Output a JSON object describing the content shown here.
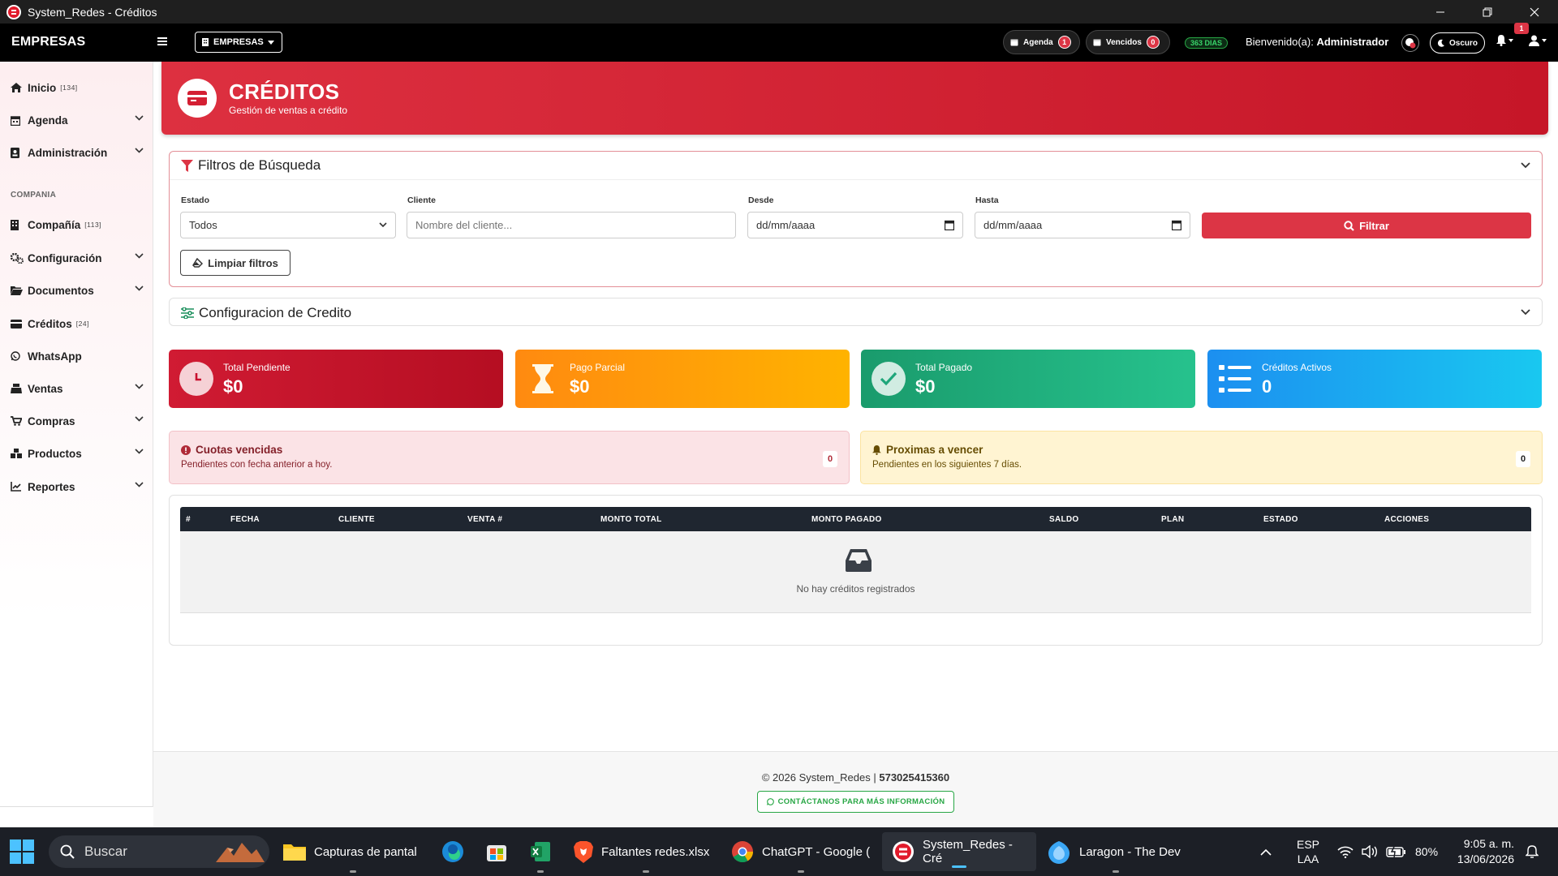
{
  "window": {
    "title": "System_Redes - Créditos"
  },
  "navbar": {
    "brand": "EMPRESAS",
    "empresas_button": "EMPRESAS",
    "agenda_label": "Agenda",
    "agenda_count": "1",
    "vencidos_label": "Vencidos",
    "vencidos_count": "0",
    "days_badge": "363 DIAS",
    "welcome_prefix": "Bienvenido(a):",
    "welcome_user": "Administrador",
    "dark_mode_label": "Oscuro",
    "notifications_count": "1"
  },
  "sidebar": {
    "items": [
      {
        "label": "Inicio",
        "badge": "[134]"
      },
      {
        "label": "Agenda"
      },
      {
        "label": "Administración"
      },
      {
        "label": "Compañía",
        "badge": "[113]"
      },
      {
        "label": "Configuración"
      },
      {
        "label": "Documentos"
      },
      {
        "label": "Créditos",
        "badge": "[24]"
      },
      {
        "label": "WhatsApp"
      },
      {
        "label": "Ventas"
      },
      {
        "label": "Compras"
      },
      {
        "label": "Productos"
      },
      {
        "label": "Reportes"
      }
    ],
    "section_label": "COMPANIA"
  },
  "hero": {
    "title": "CRÉDITOS",
    "subtitle": "Gestión de ventas a crédito"
  },
  "filters": {
    "title": "Filtros de Búsqueda",
    "estado_label": "Estado",
    "estado_value": "Todos",
    "cliente_label": "Cliente",
    "cliente_placeholder": "Nombre del cliente...",
    "desde_label": "Desde",
    "desde_value": "dd/mm/aaaa",
    "hasta_label": "Hasta",
    "hasta_value": "dd/mm/aaaa",
    "filter_button": "Filtrar",
    "clear_button": "Limpiar filtros"
  },
  "credit_config": {
    "title": "Configuracion de Credito"
  },
  "stats": [
    {
      "label": "Total Pendiente",
      "value": "$0",
      "color": "#c8102e"
    },
    {
      "label": "Pago Parcial",
      "value": "$0",
      "color": "#ff9f10"
    },
    {
      "label": "Total Pagado",
      "value": "$0",
      "color": "#1fa67a"
    },
    {
      "label": "Créditos Activos",
      "value": "0",
      "color": "#1ea7f0"
    }
  ],
  "alerts": {
    "overdue": {
      "title": "Cuotas vencidas",
      "subtitle": "Pendientes con fecha anterior a hoy.",
      "count": "0"
    },
    "upcoming": {
      "title": "Proximas a vencer",
      "subtitle": "Pendientes en los siguientes 7 días.",
      "count": "0"
    }
  },
  "table": {
    "columns": [
      "#",
      "FECHA",
      "CLIENTE",
      "VENTA #",
      "MONTO TOTAL",
      "MONTO PAGADO",
      "SALDO",
      "PLAN",
      "ESTADO",
      "ACCIONES"
    ],
    "empty_message": "No hay créditos registrados"
  },
  "footer": {
    "copyright": "© 2026 System_Redes |",
    "phone": "573025415360",
    "contact_button": "CONTÁCTANOS PARA MÁS INFORMACIÓN"
  },
  "taskbar": {
    "search_placeholder": "Buscar",
    "apps": [
      {
        "label": "Capturas de pantal",
        "icon": "folder-icon"
      },
      {
        "label": "",
        "icon": "edge-icon"
      },
      {
        "label": "",
        "icon": "store-icon"
      },
      {
        "label": "",
        "icon": "excel-icon"
      },
      {
        "label": "Faltantes redes.xlsx",
        "icon": "brave-icon"
      },
      {
        "label": "ChatGPT - Google (",
        "icon": "chrome-icon"
      },
      {
        "label": "System_Redes - Cré",
        "icon": "system-redes-icon"
      },
      {
        "label": "Laragon - The Dev",
        "icon": "laragon-icon"
      }
    ],
    "lang_top": "ESP",
    "lang_bottom": "LAA",
    "battery": "80%",
    "time": "9:05 a. m.",
    "date": "13/06/2026"
  },
  "colors": {
    "accent": "#dc3545",
    "navbar": "#000000",
    "success": "#28a745"
  }
}
